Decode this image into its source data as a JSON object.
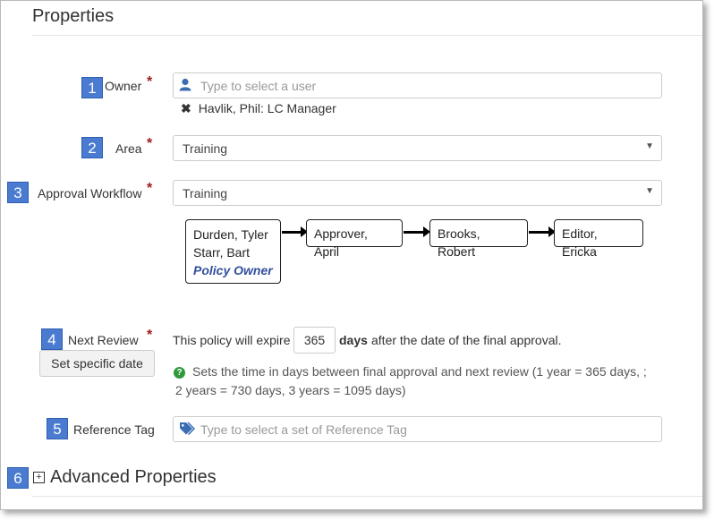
{
  "section_title": "Properties",
  "badges": [
    "1",
    "2",
    "3",
    "4",
    "5",
    "6"
  ],
  "owner": {
    "label": "Owner",
    "required_mark": "*",
    "placeholder": "Type to select a user",
    "selected": "Havlik, Phil: LC Manager",
    "remove_icon": "x-icon",
    "user_icon": "user-icon"
  },
  "area": {
    "label": "Area",
    "required_mark": "*",
    "value": "Training"
  },
  "approval_workflow": {
    "label": "Approval Workflow",
    "required_mark": "*",
    "value": "Training",
    "steps": [
      {
        "lines": [
          "Durden, Tyler",
          "Starr, Bart"
        ],
        "owner_label": "Policy Owner"
      },
      {
        "lines": [
          "Approver, April"
        ]
      },
      {
        "lines": [
          "Brooks, Robert"
        ]
      },
      {
        "lines": [
          "Editor, Ericka"
        ]
      }
    ]
  },
  "next_review": {
    "label": "Next Review",
    "required_mark": "*",
    "button": "Set specific date",
    "prefix": "This policy will expire",
    "days_value": "365",
    "days_word": "days",
    "suffix": "after the date of the final approval.",
    "help_line1": "Sets the time in days between final approval and next review (1 year = 365 days, ;",
    "help_line2": "2 years = 730 days, 3 years = 1095 days)",
    "help_icon": "question-circle-icon"
  },
  "reference_tag": {
    "label": "Reference Tag",
    "placeholder": "Type to select a set of Reference Tag",
    "tag_icon": "tag-icon"
  },
  "advanced": {
    "label": "Advanced Properties",
    "toggle": "+"
  }
}
